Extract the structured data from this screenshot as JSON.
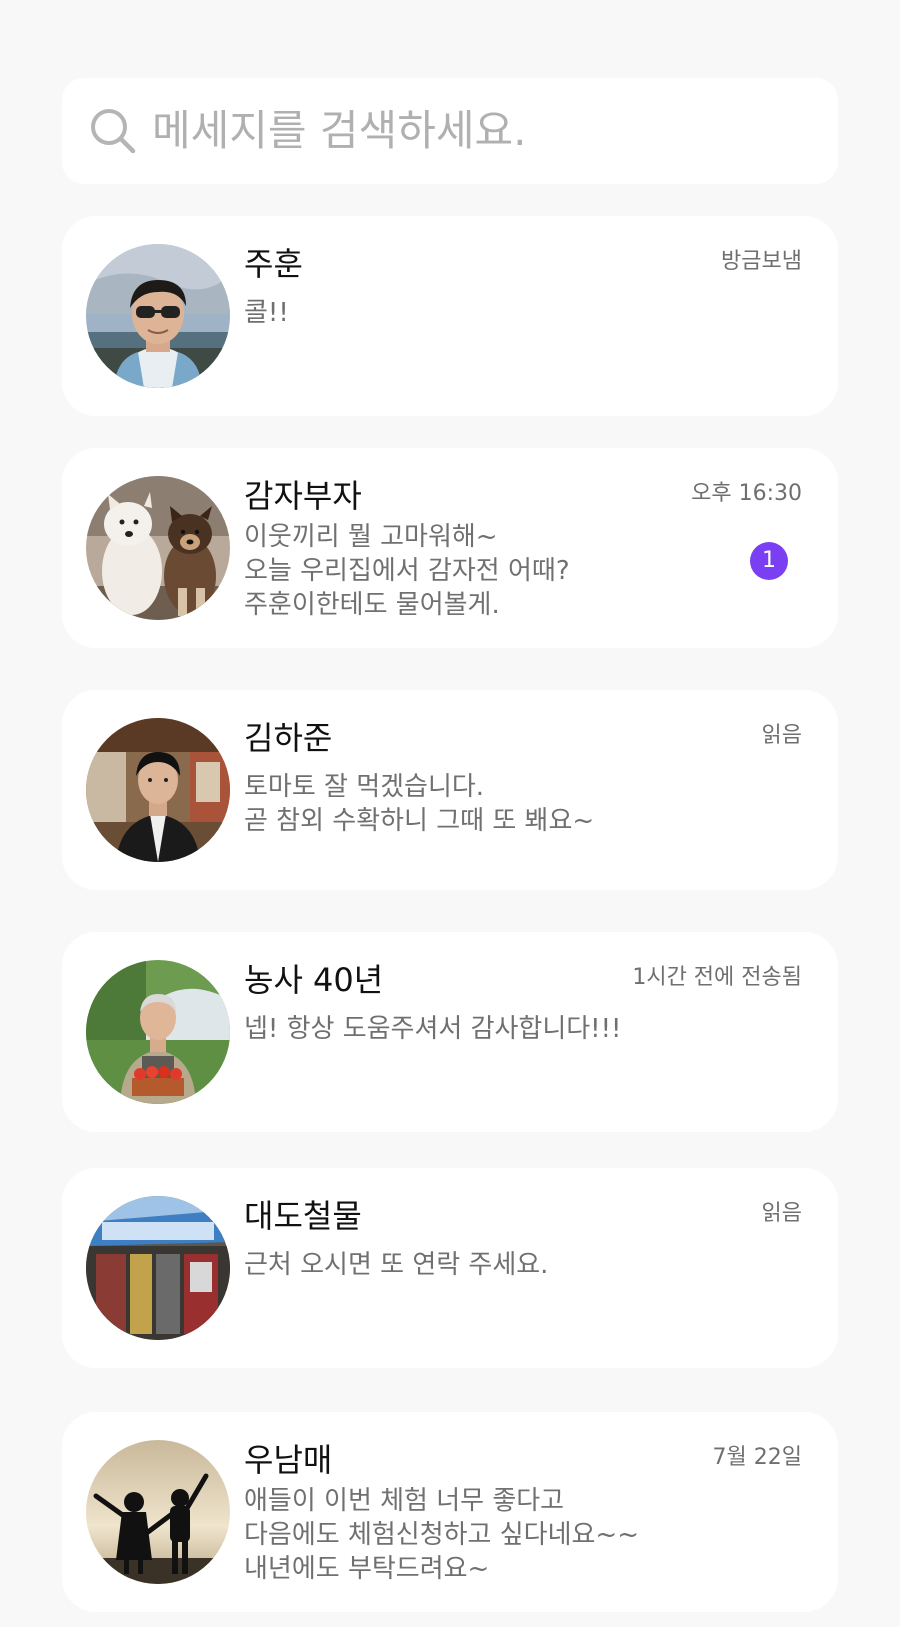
{
  "search": {
    "placeholder": "메세지를 검색하세요."
  },
  "accent_color": "#7a3ff2",
  "conversations": [
    {
      "name": "주훈",
      "time": "방금보냄",
      "message": "콜!!",
      "avatar": "man-with-sunglasses-at-beach",
      "unread": ""
    },
    {
      "name": "감자부자",
      "time": "오후 16:30",
      "message": "이웃끼리 뭘 고마워해~\n오늘 우리집에서 감자전 어때?\n주훈이한테도 물어볼게.",
      "avatar": "two-puppies",
      "unread": "1"
    },
    {
      "name": "김하준",
      "time": "읽음",
      "message": "토마토 잘 먹겠습니다.\n곧 참외 수확하니 그때 또 봬요~",
      "avatar": "young-man-in-black-jacket",
      "unread": ""
    },
    {
      "name": "농사 40년",
      "time": "1시간 전에 전송됨",
      "message": "넵! 항상 도움주셔서 감사합니다!!!",
      "avatar": "farmer-holding-tomatoes",
      "unread": ""
    },
    {
      "name": "대도철물",
      "time": "읽음",
      "message": "근처 오시면 또 연락 주세요.",
      "avatar": "hardware-store-front",
      "unread": ""
    },
    {
      "name": "우남매",
      "time": "7월 22일",
      "message": "애들이 이번 체험 너무 좋다고\n다음에도 체험신청하고 싶다네요~~\n내년에도 부탁드려요~",
      "avatar": "two-children-silhouette-sunset",
      "unread": ""
    }
  ]
}
